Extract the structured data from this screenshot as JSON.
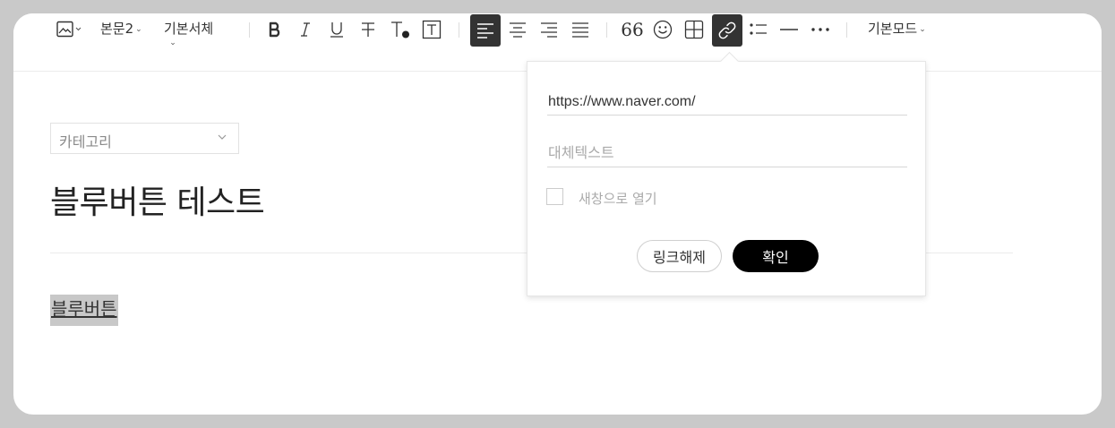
{
  "toolbar": {
    "image_icon": "image-icon",
    "paragraph_style": "본문2",
    "font_family": "기본서체",
    "buttons": [
      "bold",
      "italic",
      "underline",
      "strikethrough",
      "text-color",
      "text-background"
    ],
    "align_buttons": [
      "align-left",
      "align-center",
      "align-right",
      "align-justify"
    ],
    "insert_buttons": [
      "quote",
      "emoji",
      "table",
      "link",
      "list",
      "horizontal-line",
      "more"
    ],
    "quote_label": "66",
    "mode": "기본모드",
    "active_color": "#333333"
  },
  "editor": {
    "category_placeholder": "카테고리",
    "title": "블루버튼 테스트",
    "body_text": "블루버튼"
  },
  "link_popover": {
    "url_value": "https://www.naver.com/",
    "alt_text_placeholder": "대체텍스트",
    "new_window_label": "새창으로 열기",
    "unlink_label": "링크해제",
    "confirm_label": "확인"
  }
}
